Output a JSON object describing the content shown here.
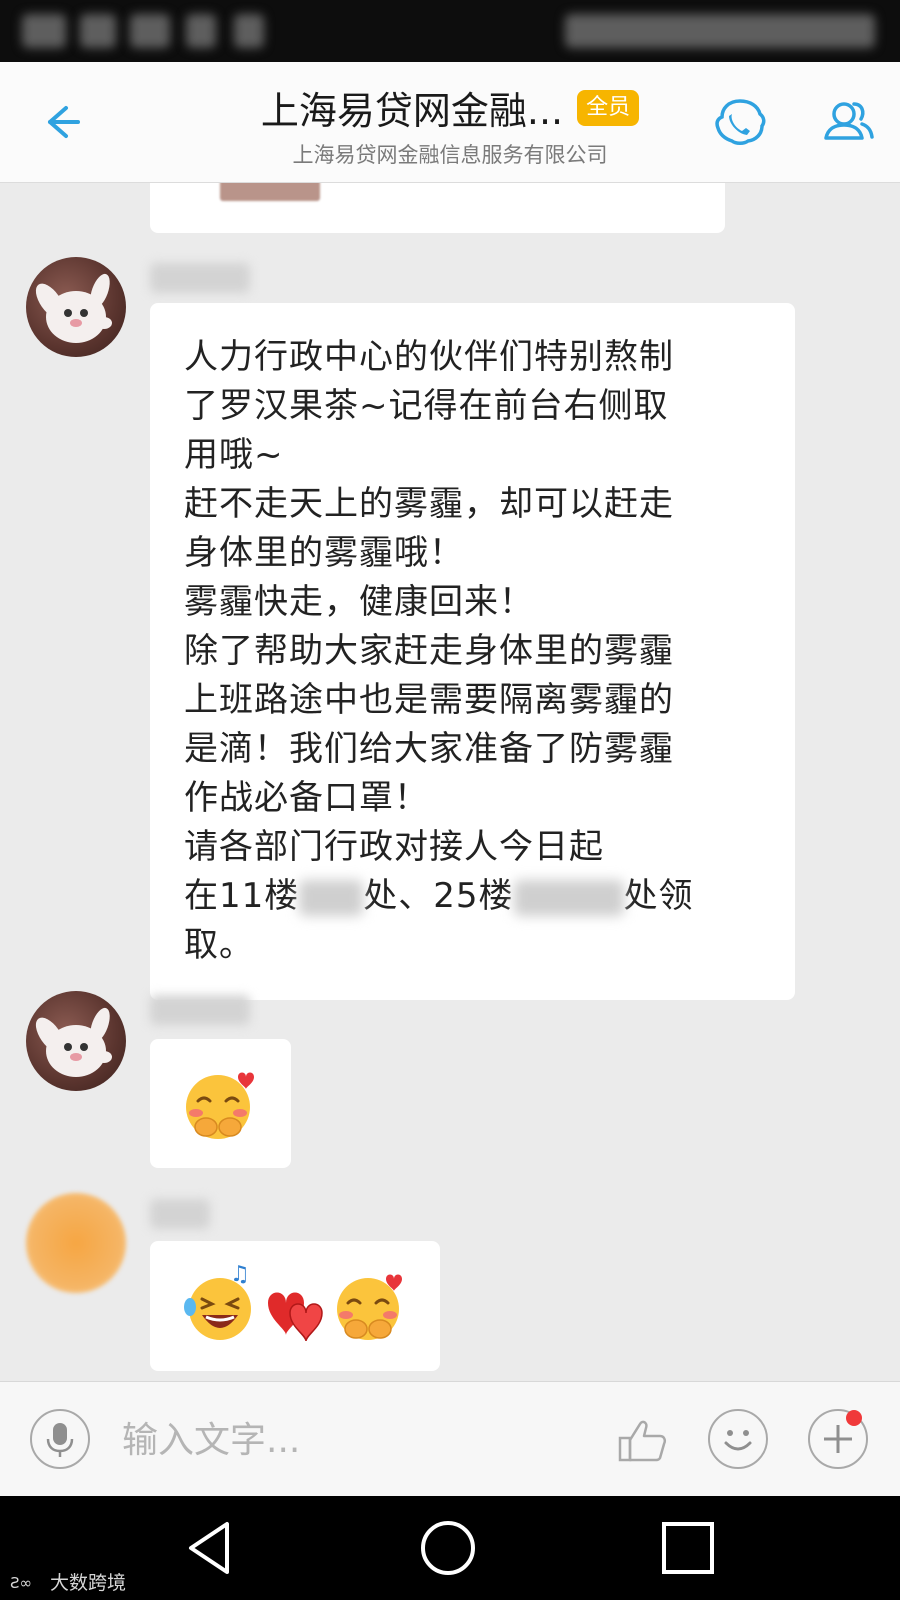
{
  "header": {
    "title": "上海易贷网金融...",
    "badge": "全员",
    "subtitle": "上海易贷网金融信息服务有限公司"
  },
  "messages": [
    {
      "type": "text",
      "lines_part1": [
        "人力行政中心的伙伴们特别熬制",
        "了罗汉果茶~记得在前台右侧取",
        "用哦~",
        "赶不走天上的雾霾，却可以赶走",
        "身体里的雾霾哦！",
        "雾霾快走，健康回来！",
        "除了帮助大家赶走身体里的雾霾",
        "上班路途中也是需要隔离雾霾的",
        "是滴！我们给大家准备了防雾霾",
        "作战必备口罩！",
        "请各部门行政对接人今日起"
      ],
      "line_masked": {
        "prefix": "在11楼",
        "mid1": "处、25楼",
        "mid2": "处领"
      },
      "line_last": "取。"
    },
    {
      "type": "emoji",
      "emojis": [
        "shy-blush-emoji"
      ]
    },
    {
      "type": "emoji",
      "emojis": [
        "laughing-music-emoji",
        "two-hearts-emoji",
        "shy-blush-emoji"
      ]
    }
  ],
  "input_bar": {
    "placeholder": "输入文字..."
  },
  "icons": {
    "back": "back-arrow-icon",
    "call": "phone-call-icon",
    "members": "group-members-icon",
    "mic": "microphone-icon",
    "like": "thumbs-up-icon",
    "emoji": "smiley-icon",
    "plus": "plus-icon"
  },
  "colors": {
    "accent": "#2fa2e0",
    "badge": "#f7b500",
    "notification_dot": "#f0393a"
  },
  "watermark": "大数跨境"
}
